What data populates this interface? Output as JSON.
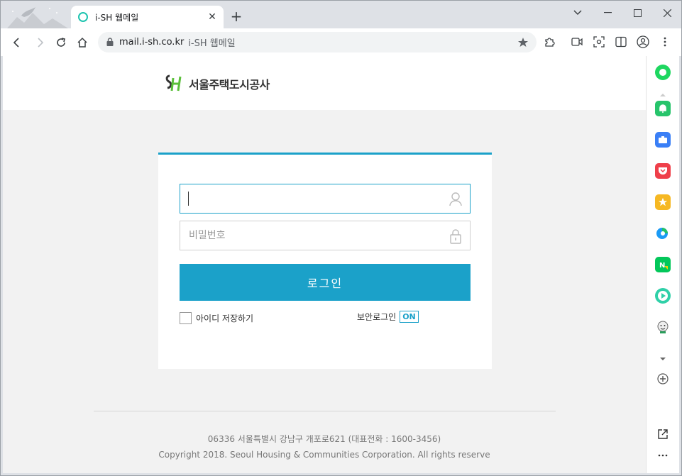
{
  "browser": {
    "tab_title": "i-SH 웹메일",
    "url": "mail.i-sh.co.kr",
    "url_suffix": "i-SH 웹메일"
  },
  "site": {
    "logo_text": "서울주택도시공사"
  },
  "login": {
    "id_value": "",
    "password_placeholder": "비밀번호",
    "login_button": "로그인",
    "save_id_label": "아이디 저장하기",
    "secure_login_label": "보안로그인",
    "secure_login_state": "ON"
  },
  "footer": {
    "address": "06336 서울특별시 강남구 개포로621 (대표전화 : 1600-3456)",
    "copyright": "Copyright 2018. Seoul Housing & Communities Corporation. All rights reserve"
  },
  "colors": {
    "accent": "#1ba1c9",
    "brand_green": "#5bbf3a"
  }
}
